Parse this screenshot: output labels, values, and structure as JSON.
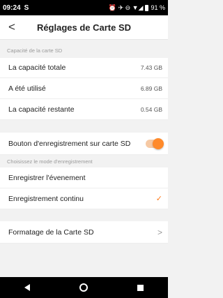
{
  "status_bar": {
    "time": "09:24",
    "s_icon": "S",
    "right_icons": "⏰ ✈ ⊖ ▼◢",
    "battery": "91 %"
  },
  "header": {
    "back": "<",
    "title": "Réglages de Carte SD"
  },
  "capacity": {
    "section_label": "Capacité de la carte SD",
    "total_label": "La capacité totale",
    "total_value": "7.43 GB",
    "used_label": "A été utilisé",
    "used_value": "6.89 GB",
    "remaining_label": "La capacité restante",
    "remaining_value": "0.54 GB"
  },
  "recording_toggle": {
    "label": "Bouton d'enregistrement sur carte SD",
    "enabled": true
  },
  "mode": {
    "section_label": "Choisissez le mode d'enregistrement",
    "event_label": "Enregistrer l'évenement",
    "continuous_label": "Enregistrement continu",
    "selected": "continuous",
    "check": "✓"
  },
  "format": {
    "label": "Formatage de la Carte SD",
    "chevron": ">"
  },
  "colors": {
    "accent": "#ff8a2b",
    "background": "#f2f2f2"
  }
}
